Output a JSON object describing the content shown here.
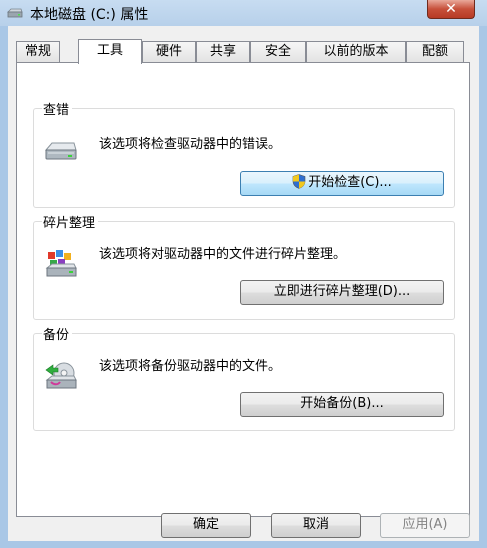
{
  "window": {
    "title": "本地磁盘 (C:) 属性",
    "close_label": "✕"
  },
  "tabs": [
    {
      "label": "常规"
    },
    {
      "label": "工具"
    },
    {
      "label": "硬件"
    },
    {
      "label": "共享"
    },
    {
      "label": "安全"
    },
    {
      "label": "以前的版本"
    },
    {
      "label": "配额"
    }
  ],
  "active_tab": "工具",
  "groups": {
    "error_check": {
      "title": "查错",
      "description": "该选项将检查驱动器中的错误。",
      "button": "开始检查(C)..."
    },
    "defrag": {
      "title": "碎片整理",
      "description": "该选项将对驱动器中的文件进行碎片整理。",
      "button": "立即进行碎片整理(D)..."
    },
    "backup": {
      "title": "备份",
      "description": "该选项将备份驱动器中的文件。",
      "button": "开始备份(B)..."
    }
  },
  "footer": {
    "ok": "确定",
    "cancel": "取消",
    "apply": "应用(A)"
  }
}
